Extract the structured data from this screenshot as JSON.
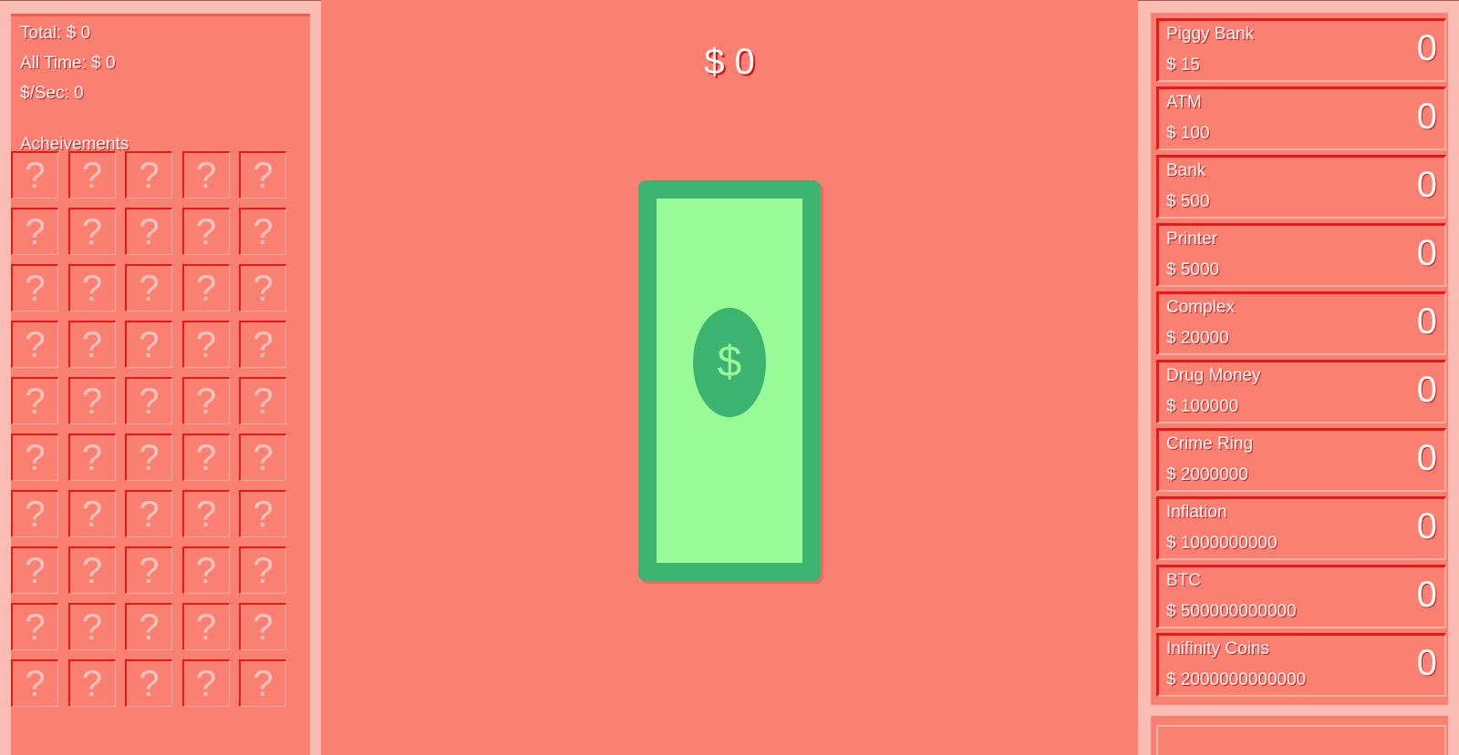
{
  "stats": {
    "total": "Total: $ 0",
    "all_time": "All Time: $ 0",
    "per_sec": "$/Sec: 0"
  },
  "achievements": {
    "title": "Acheivements",
    "locked_symbol": "?",
    "count": 50
  },
  "money": {
    "display": "$ 0"
  },
  "bill": {
    "symbol": "$"
  },
  "shop": [
    {
      "name": "Piggy Bank",
      "price": "$ 15",
      "count": "0"
    },
    {
      "name": "ATM",
      "price": "$ 100",
      "count": "0"
    },
    {
      "name": "Bank",
      "price": "$ 500",
      "count": "0"
    },
    {
      "name": "Printer",
      "price": "$ 5000",
      "count": "0"
    },
    {
      "name": "Complex",
      "price": "$ 20000",
      "count": "0"
    },
    {
      "name": "Drug Money",
      "price": "$ 100000",
      "count": "0"
    },
    {
      "name": "Crime Ring",
      "price": "$ 2000000",
      "count": "0"
    },
    {
      "name": "Inflation",
      "price": "$ 1000000000",
      "count": "0"
    },
    {
      "name": "BTC",
      "price": "$ 500000000000",
      "count": "0"
    },
    {
      "name": "Inifinity Coins",
      "price": "$ 2000000000000",
      "count": "0"
    }
  ],
  "colors": {
    "background": "#fa8072",
    "panel": "#fbbcb3",
    "bill_dark": "#3cb371",
    "bill_light": "#98fb98",
    "accent_red": "#e81818"
  }
}
